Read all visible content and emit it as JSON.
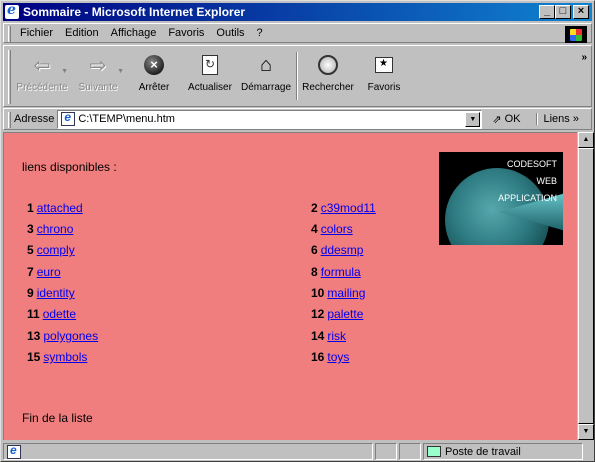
{
  "window": {
    "title": "Sommaire - Microsoft Internet Explorer",
    "minimize": "_",
    "maximize": "□",
    "close": "×"
  },
  "menu": [
    {
      "label": "Fichier",
      "accel": "F"
    },
    {
      "label": "Edition",
      "accel": "E"
    },
    {
      "label": "Affichage",
      "accel": "h"
    },
    {
      "label": "Favoris",
      "accel": "v"
    },
    {
      "label": "Outils",
      "accel": "O"
    },
    {
      "label": "?",
      "accel": "?"
    }
  ],
  "toolbar": {
    "back": "Précédente",
    "forward": "Suivante",
    "stop": "Arrêter",
    "refresh": "Actualiser",
    "home": "Démarrage",
    "search": "Rechercher",
    "favorites": "Favoris",
    "more": "»"
  },
  "address": {
    "label": "Adresse",
    "value": "C:\\TEMP\\menu.htm",
    "go": "OK",
    "links": "Liens »"
  },
  "page": {
    "heading": "liens disponibles :",
    "footer": "Fin de la liste",
    "logo_lines": [
      "CODESOFT",
      "WEB",
      "APPLICATION"
    ],
    "background": "#f07e7e",
    "link_color": "#0000ee",
    "links": [
      {
        "num": "1",
        "text": "attached"
      },
      {
        "num": "2",
        "text": "c39mod11"
      },
      {
        "num": "3",
        "text": "chrono"
      },
      {
        "num": "4",
        "text": "colors"
      },
      {
        "num": "5",
        "text": "comply"
      },
      {
        "num": "6",
        "text": "ddesmp"
      },
      {
        "num": "7",
        "text": "euro"
      },
      {
        "num": "8",
        "text": "formula"
      },
      {
        "num": "9",
        "text": "identity"
      },
      {
        "num": "10",
        "text": "mailing"
      },
      {
        "num": "11",
        "text": "odette"
      },
      {
        "num": "12",
        "text": "palette"
      },
      {
        "num": "13",
        "text": "polygones"
      },
      {
        "num": "14",
        "text": "risk"
      },
      {
        "num": "15",
        "text": "symbols"
      },
      {
        "num": "16",
        "text": "toys"
      }
    ]
  },
  "status": {
    "text": "",
    "zone": "Poste de travail"
  }
}
